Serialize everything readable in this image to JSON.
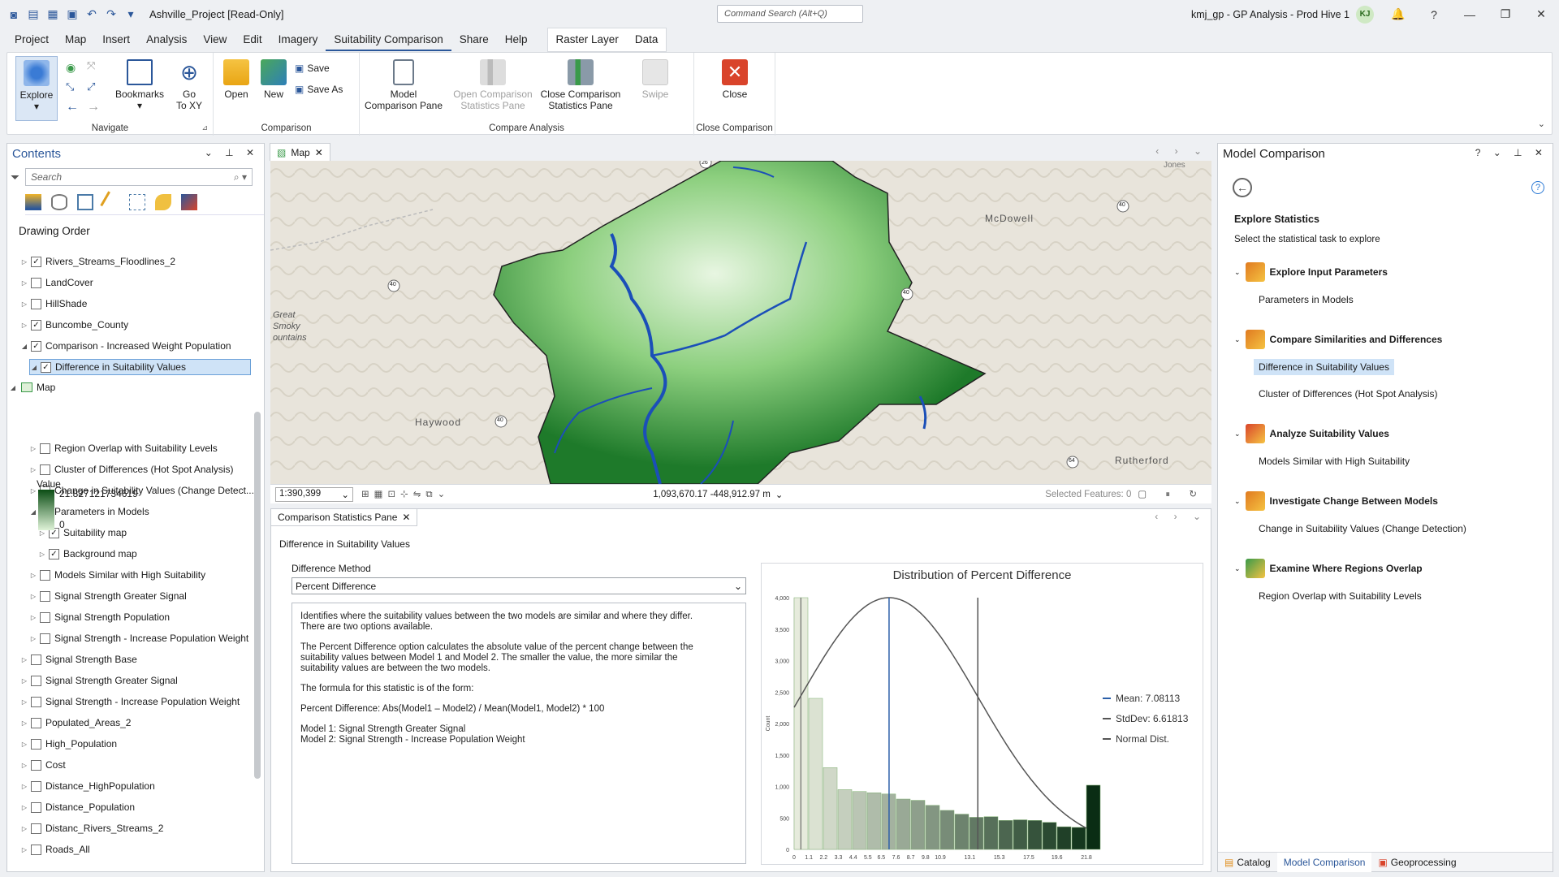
{
  "titlebar": {
    "project": "Ashville_Project [Read-Only]",
    "command_search_placeholder": "Command Search (Alt+Q)",
    "app_title": "kmj_gp - GP Analysis - Prod Hive 1",
    "user_initials": "KJ"
  },
  "menu": {
    "items": [
      "Project",
      "Map",
      "Insert",
      "Analysis",
      "View",
      "Edit",
      "Imagery",
      "Suitability Comparison",
      "Share",
      "Help"
    ],
    "context": [
      "Raster Layer",
      "Data"
    ]
  },
  "ribbon": {
    "navigate": {
      "explore": "Explore",
      "bookmarks": "Bookmarks",
      "goto": "Go",
      "goto2": "To XY",
      "label": "Navigate"
    },
    "comparison": {
      "open": "Open",
      "new": "New",
      "save": "Save",
      "save_as": "Save As",
      "label": "Comparison"
    },
    "compare": {
      "model1": "Model",
      "model2": "Comparison Pane",
      "open1": "Open Comparison",
      "open2": "Statistics Pane",
      "close1": "Close Comparison",
      "close2": "Statistics Pane",
      "swipe": "Swipe",
      "label": "Compare Analysis"
    },
    "close": {
      "close": "Close",
      "label": "Close Comparison"
    }
  },
  "contents": {
    "title": "Contents",
    "search_placeholder": "Search",
    "drawing_order": "Drawing Order",
    "map": "Map",
    "legend_value": "Value",
    "legend_max": "21.827121734619",
    "legend_min": "0",
    "layers": [
      {
        "label": "Rivers_Streams_Floodlines_2",
        "checked": true,
        "indent": 0
      },
      {
        "label": "LandCover",
        "checked": false,
        "indent": 0
      },
      {
        "label": "HillShade",
        "checked": false,
        "indent": 0
      },
      {
        "label": "Buncombe_County",
        "checked": true,
        "indent": 0
      },
      {
        "label": "Comparison - Increased Weight Population",
        "checked": true,
        "indent": 0,
        "open": true
      },
      {
        "label": "Difference in Suitability Values",
        "checked": true,
        "indent": 1,
        "open": true,
        "selected": true
      },
      {
        "label": "Region Overlap with Suitability Levels",
        "checked": false,
        "indent": 1
      },
      {
        "label": "Cluster of Differences (Hot Spot Analysis)",
        "checked": false,
        "indent": 1
      },
      {
        "label": "Change in Suitability Values (Change Detect...",
        "checked": false,
        "indent": 1
      },
      {
        "label": "Parameters in Models",
        "checked": false,
        "indent": 1,
        "open": true
      },
      {
        "label": "Suitability map",
        "checked": true,
        "indent": 2
      },
      {
        "label": "Background map",
        "checked": true,
        "indent": 2
      },
      {
        "label": "Models Similar with High Suitability",
        "checked": false,
        "indent": 1
      },
      {
        "label": "Signal Strength Greater Signal",
        "checked": false,
        "indent": 1
      },
      {
        "label": "Signal Strength Population",
        "checked": false,
        "indent": 1
      },
      {
        "label": "Signal Strength - Increase Population Weight",
        "checked": false,
        "indent": 1
      },
      {
        "label": "Signal Strength Base",
        "checked": false,
        "indent": 0
      },
      {
        "label": "Signal Strength Greater Signal",
        "checked": false,
        "indent": 0
      },
      {
        "label": "Signal Strength - Increase Population Weight",
        "checked": false,
        "indent": 0
      },
      {
        "label": "Populated_Areas_2",
        "checked": false,
        "indent": 0
      },
      {
        "label": "High_Population",
        "checked": false,
        "indent": 0
      },
      {
        "label": "Cost",
        "checked": false,
        "indent": 0
      },
      {
        "label": "Distance_HighPopulation",
        "checked": false,
        "indent": 0
      },
      {
        "label": "Distance_Population",
        "checked": false,
        "indent": 0
      },
      {
        "label": "Distanc_Rivers_Streams_2",
        "checked": false,
        "indent": 0
      },
      {
        "label": "Roads_All",
        "checked": false,
        "indent": 0
      }
    ]
  },
  "map": {
    "tab": "Map",
    "labels": [
      "McDowell",
      "Great",
      "Smoky",
      "ountains",
      "Haywood",
      "Rutherford",
      "Jones"
    ],
    "shields": [
      "26",
      "40",
      "40",
      "40",
      "40",
      "64"
    ],
    "scale": "1:390,399",
    "coords": "1,093,670.17 -448,912.97 m",
    "selected_features": "Selected Features: 0"
  },
  "stats": {
    "tab": "Comparison Statistics Pane",
    "section": "Difference in Suitability Values",
    "method_label": "Difference Method",
    "method_value": "Percent Difference",
    "description": [
      "Identifies where the suitability values between the two models are similar and where they differ.\nThere are two options available.",
      "The Percent Difference option calculates the absolute value of the percent change between the\nsuitability values between Model 1 and Model 2. The smaller the value, the more similar the\nsuitability values are between the two models.",
      "The formula for this statistic is of the form:",
      "Percent Difference:  Abs(Model1 – Model2) / Mean(Model1, Model2) * 100",
      "Model 1: Signal Strength Greater Signal\nModel 2: Signal Strength - Increase Population Weight"
    ]
  },
  "chart_data": {
    "type": "bar",
    "title": "Distribution of Percent Difference",
    "ylabel": "Count",
    "xlabel": "",
    "ylim": [
      0,
      4000
    ],
    "xlim": [
      0,
      21.8
    ],
    "yticks": [
      "0",
      "500",
      "1,000",
      "1,500",
      "2,000",
      "2,500",
      "3,000",
      "3,500",
      "4,000"
    ],
    "xticks": [
      "0",
      "1.1",
      "2.2",
      "3.3",
      "4.4",
      "5.5",
      "6.5",
      "7.6",
      "8.7",
      "9.8",
      "10.9",
      "13.1",
      "15.3",
      "17.5",
      "19.6",
      "21.8"
    ],
    "xtick_values": [
      0,
      1.1,
      2.2,
      3.3,
      4.4,
      5.5,
      6.5,
      7.6,
      8.7,
      9.8,
      10.9,
      13.1,
      15.3,
      17.5,
      19.6,
      21.8
    ],
    "bin_width": 1.09,
    "values": [
      4000,
      2400,
      1300,
      950,
      920,
      900,
      880,
      800,
      780,
      700,
      620,
      560,
      510,
      520,
      460,
      470,
      460,
      430,
      360,
      350,
      1020
    ],
    "mean": 7.08113,
    "stddev": 6.61813,
    "mean_plus_std": 13.69926,
    "normal_peak": 4000,
    "legend": [
      "Mean: 7.08113",
      "StdDev: 6.61813",
      "Normal Dist."
    ],
    "colors": {
      "mean": "#2b5fa8",
      "std": "#555555",
      "normal": "#555555"
    }
  },
  "model_comparison": {
    "title": "Model Comparison",
    "heading": "Explore Statistics",
    "subtitle": "Select the statistical task to explore",
    "tasks": [
      {
        "title": "Explore Input Parameters",
        "subs": [
          "Parameters in Models"
        ]
      },
      {
        "title": "Compare Similarities and Differences",
        "subs": [
          "Difference in Suitability Values",
          "Cluster of Differences (Hot Spot Analysis)"
        ]
      },
      {
        "title": "Analyze Suitability Values",
        "subs": [
          "Models Similar with High Suitability"
        ]
      },
      {
        "title": "Investigate Change Between Models",
        "subs": [
          "Change in Suitability Values (Change Detection)"
        ]
      },
      {
        "title": "Examine Where Regions Overlap",
        "subs": [
          "Region Overlap with Suitability Levels"
        ]
      }
    ],
    "bottom_tabs": [
      "Catalog",
      "Model Comparison",
      "Geoprocessing"
    ]
  }
}
